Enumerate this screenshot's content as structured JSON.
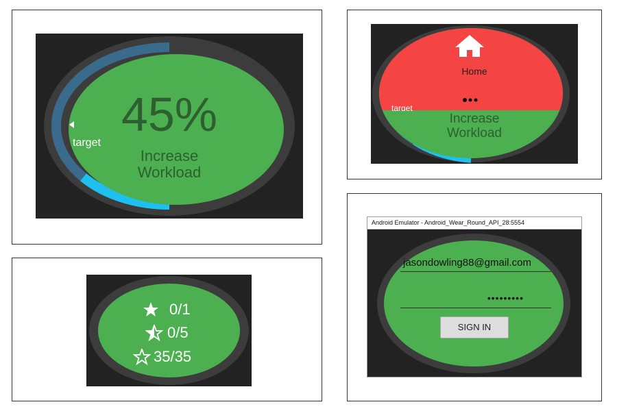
{
  "colors": {
    "face_green": "#4caf50",
    "bezel": "#3c3c3c",
    "screen_bg": "#222222",
    "target_track": "#3a6a8c",
    "progress_cyan": "#1ec0f0",
    "home_red": "#f44444",
    "dark_text": "#2e5f31"
  },
  "progress_watch": {
    "percent_label": "45%",
    "progress_fraction": 0.45,
    "target_label": "target",
    "action_line1": "Increase",
    "action_line2": "Workload"
  },
  "menu_watch": {
    "home_icon": "home-icon",
    "home_label": "Home",
    "peek_label": "target",
    "action_line1": "Increase",
    "action_line2": "Workload"
  },
  "stars_watch": {
    "rows": [
      {
        "icon": "star-filled-icon",
        "value": "0/1"
      },
      {
        "icon": "star-half-icon",
        "value": "0/5"
      },
      {
        "icon": "star-outline-icon",
        "value": "35/35"
      }
    ]
  },
  "login_watch": {
    "window_title": "Android Emulator - Android_Wear_Round_API_28:5554",
    "email_value": "jasondowling88@gmail.com",
    "password_value": "•••••••••",
    "sign_in_label": "SIGN IN"
  }
}
